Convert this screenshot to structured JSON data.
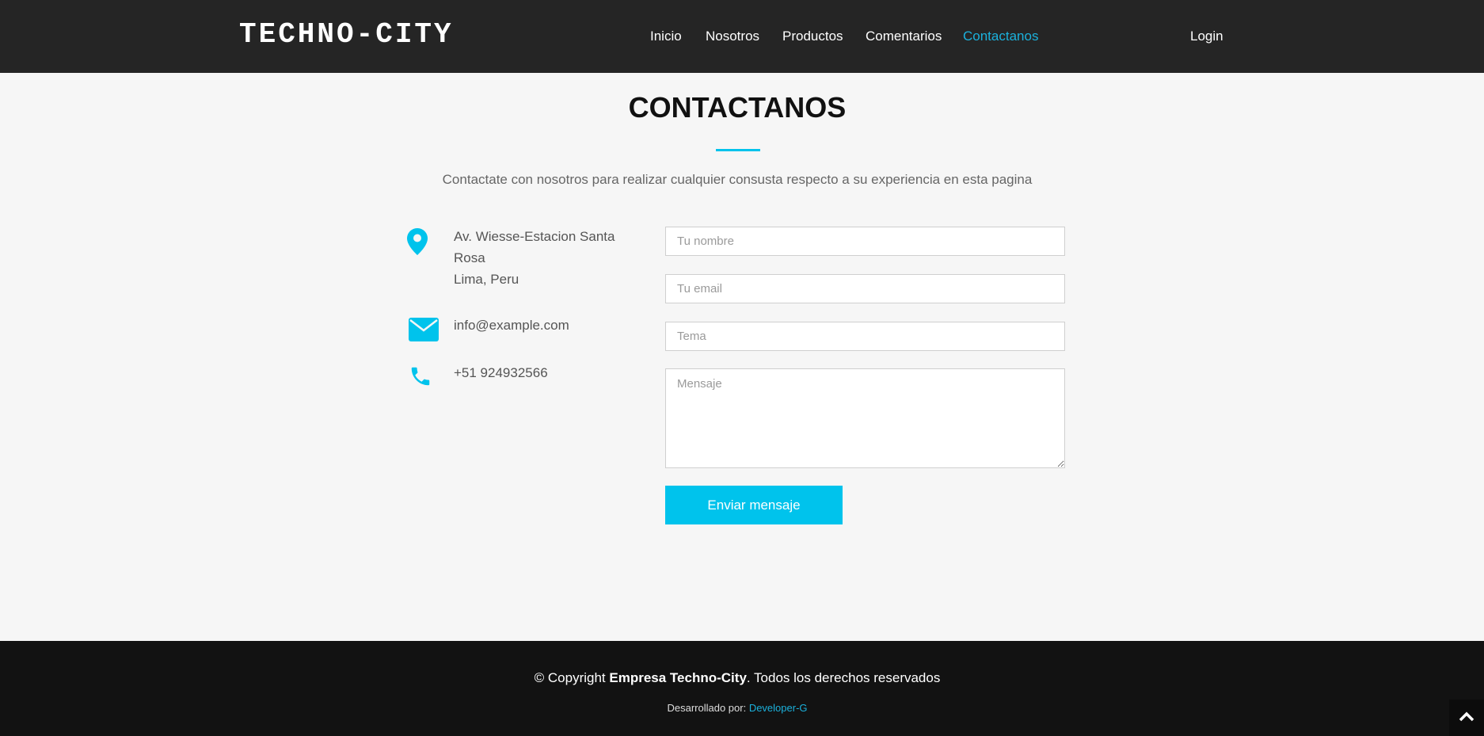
{
  "header": {
    "logo": "TECHNO-CITY",
    "nav": [
      {
        "label": "Inicio"
      },
      {
        "label": "Nosotros"
      },
      {
        "label": "Productos"
      },
      {
        "label": "Comentarios"
      },
      {
        "label": "Contactanos",
        "active": true
      }
    ],
    "login_label": "Login"
  },
  "contact": {
    "title": "CONTACTANOS",
    "subtitle": "Contactate con nosotros para realizar cualquier consusta respecto a su experiencia en esta pagina",
    "address_line1": "Av. Wiesse-Estacion Santa",
    "address_line2": "Rosa",
    "address_line3": "Lima, Peru",
    "email": "info@example.com",
    "phone": "+51 924932566"
  },
  "form": {
    "name_placeholder": "Tu nombre",
    "email_placeholder": "Tu email",
    "subject_placeholder": "Tema",
    "message_placeholder": "Mensaje",
    "submit_label": "Enviar mensaje"
  },
  "footer": {
    "copyright_prefix": "© Copyright",
    "company": "Empresa Techno-City",
    "copyright_suffix": ". Todos los derechos reservados",
    "developed_by": "Desarrollado por:",
    "developer": "Developer-G"
  },
  "icons": {
    "location": "map-marker-icon",
    "email": "envelope-icon",
    "phone": "phone-icon",
    "back_to_top": "chevron-up-icon"
  },
  "colors": {
    "accent": "#00c3ec",
    "nav_active": "#1bb1dc",
    "header_bg": "#252525",
    "footer_bg": "#121212",
    "page_bg": "#f6f6f6"
  }
}
